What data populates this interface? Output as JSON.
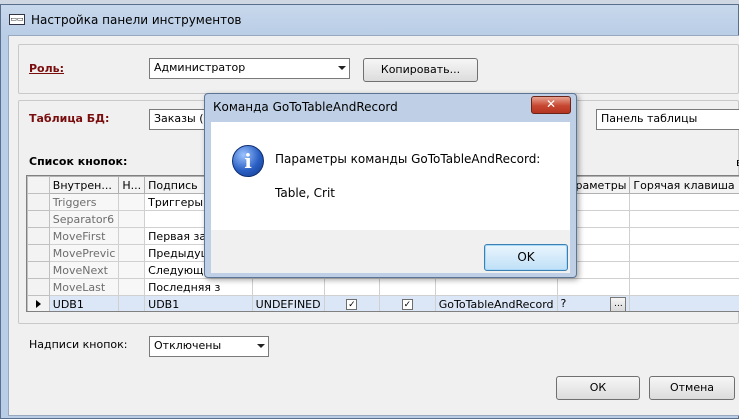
{
  "window": {
    "title": "Настройка панели инструментов",
    "icon_text": "▭▭"
  },
  "role": {
    "label": "Роль:",
    "value": "Администратор",
    "copy_button": "Копировать..."
  },
  "table_db": {
    "label": "Таблица БД:",
    "value": "Заказы (q",
    "panel_value": "Панель таблицы"
  },
  "buttons_list": {
    "label": "Список кнопок:",
    "right_hint": "в",
    "columns": [
      "Внутрен...",
      "Н...",
      "Подпись",
      "",
      "",
      "",
      "",
      "Параметры",
      "Горячая клавиша"
    ],
    "rows": [
      {
        "internal": "Triggers",
        "n": "",
        "caption": "Триггеры",
        "c4": "",
        "c5": "",
        "c6": "",
        "cmd": "",
        "params": "",
        "hotkey": "",
        "gray": true
      },
      {
        "internal": "Separator6",
        "n": "",
        "caption": "",
        "c4": "",
        "c5": "",
        "c6": "",
        "cmd": "",
        "params": "",
        "hotkey": "",
        "gray": true
      },
      {
        "internal": "MoveFirst",
        "n": "",
        "caption": "Первая запи",
        "c4": "",
        "c5": "",
        "c6": "",
        "cmd": "",
        "params": "",
        "hotkey": "",
        "gray": true
      },
      {
        "internal": "MovePrevic",
        "n": "",
        "caption": "Предыдущая",
        "c4": "",
        "c5": "",
        "c6": "",
        "cmd": "",
        "params": "",
        "hotkey": "",
        "gray": true
      },
      {
        "internal": "MoveNext",
        "n": "",
        "caption": "Следующая з",
        "c4": "",
        "c5": "",
        "c6": "",
        "cmd": "",
        "params": "",
        "hotkey": "",
        "gray": true
      },
      {
        "internal": "MoveLast",
        "n": "",
        "caption": "Последняя з",
        "c4": "",
        "c5": "",
        "c6": "",
        "cmd": "",
        "params": "",
        "hotkey": "",
        "gray": true
      },
      {
        "internal": "UDB1",
        "n": "",
        "caption": "UDB1",
        "c4": "UNDEFINED",
        "c5": "✓",
        "c6": "✓",
        "cmd": "GoToTableAndRecord",
        "params": "?",
        "hotkey": "",
        "gray": false,
        "active": true
      }
    ]
  },
  "captions": {
    "label": "Надписи кнопок:",
    "value": "Отключены"
  },
  "footer": {
    "ok": "ОК",
    "cancel": "Отмена"
  },
  "dialog": {
    "title": "Команда GoToTableAndRecord",
    "close": "✕",
    "line1": "Параметры команды GoToTableAndRecord:",
    "line2": "Table, Crit",
    "ok": "OK",
    "icon_glyph": "i"
  }
}
